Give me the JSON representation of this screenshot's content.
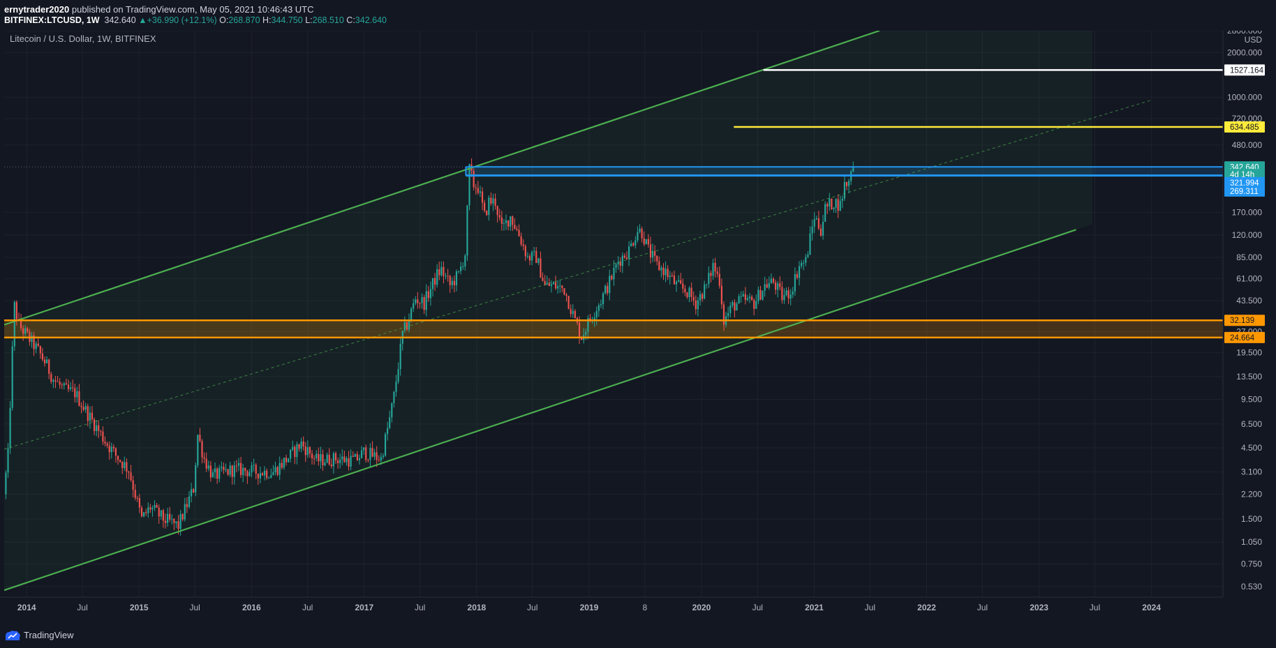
{
  "header": {
    "publisher": "ernytrader2020",
    "published_text": "published on TradingView.com, May 05, 2021 10:46:43 UTC",
    "symbol": "BITFINEX:LTCUSD, 1W",
    "last": "342.640",
    "change": "+36.990 (+12.1%)",
    "o_label": "O:",
    "o": "268.870",
    "h_label": "H:",
    "h": "344.750",
    "l_label": "L:",
    "l": "268.510",
    "c_label": "C:",
    "c": "342.640"
  },
  "footer": {
    "brand": "TradingView"
  },
  "colors": {
    "background": "#131722",
    "up": "#26a69a",
    "down": "#ef5350",
    "channel": "#4caf50",
    "zone": "#ff9800",
    "box": "#2196f3",
    "yellow": "#ffeb3b",
    "white": "#ffffff"
  },
  "chart_data": {
    "type": "candlestick",
    "title": "Litecoin / U.S. Dollar, 1W, BITFINEX",
    "y_unit": "USD",
    "y_scale": "log",
    "ylim": [
      0.45,
      2800
    ],
    "xlim": [
      "2013-10-20",
      "2024-08-20"
    ],
    "y_ticks": [
      "2800.000",
      "2000.000",
      "1000.000",
      "720.000",
      "480.000",
      "170.000",
      "120.000",
      "85.000",
      "61.000",
      "43.500",
      "27.000",
      "19.500",
      "13.500",
      "9.500",
      "6.500",
      "4.500",
      "3.100",
      "2.200",
      "1.500",
      "1.050",
      "0.750",
      "0.530"
    ],
    "x_ticks": [
      {
        "date": "2014-01-01",
        "label": "2014"
      },
      {
        "date": "2014-07-01",
        "label": "Jul"
      },
      {
        "date": "2015-01-01",
        "label": "2015"
      },
      {
        "date": "2015-07-01",
        "label": "Jul"
      },
      {
        "date": "2016-01-01",
        "label": "2016"
      },
      {
        "date": "2016-07-01",
        "label": "Jul"
      },
      {
        "date": "2017-01-01",
        "label": "2017"
      },
      {
        "date": "2017-07-01",
        "label": "Jul"
      },
      {
        "date": "2018-01-01",
        "label": "2018"
      },
      {
        "date": "2018-07-01",
        "label": "Jul"
      },
      {
        "date": "2019-01-01",
        "label": "2019"
      },
      {
        "date": "2019-07-01",
        "label": "8"
      },
      {
        "date": "2020-01-01",
        "label": "2020"
      },
      {
        "date": "2020-07-01",
        "label": "Jul"
      },
      {
        "date": "2021-01-01",
        "label": "2021"
      },
      {
        "date": "2021-07-01",
        "label": "Jul"
      },
      {
        "date": "2022-01-01",
        "label": "2022"
      },
      {
        "date": "2022-07-01",
        "label": "Jul"
      },
      {
        "date": "2023-01-01",
        "label": "2023"
      },
      {
        "date": "2023-07-01",
        "label": "Jul"
      },
      {
        "date": "2024-01-01",
        "label": "2024"
      }
    ],
    "price_anchors": [
      [
        "2013-10-22",
        2.2
      ],
      [
        "2013-11-05",
        4.0
      ],
      [
        "2013-11-19",
        20.0
      ],
      [
        "2013-11-26",
        40.0
      ],
      [
        "2013-12-10",
        30.0
      ],
      [
        "2014-01-14",
        24.0
      ],
      [
        "2014-02-11",
        20.0
      ],
      [
        "2014-03-04",
        17.0
      ],
      [
        "2014-04-01",
        13.0
      ],
      [
        "2014-05-06",
        11.0
      ],
      [
        "2014-06-10",
        10.5
      ],
      [
        "2014-07-15",
        8.0
      ],
      [
        "2014-09-16",
        5.0
      ],
      [
        "2014-10-21",
        4.0
      ],
      [
        "2014-12-02",
        3.2
      ],
      [
        "2015-01-13",
        1.5
      ],
      [
        "2015-02-10",
        1.8
      ],
      [
        "2015-03-24",
        1.5
      ],
      [
        "2015-05-12",
        1.35
      ],
      [
        "2015-06-30",
        2.4
      ],
      [
        "2015-07-14",
        5.5
      ],
      [
        "2015-08-04",
        3.8
      ],
      [
        "2015-09-01",
        2.9
      ],
      [
        "2015-11-03",
        3.2
      ],
      [
        "2015-12-01",
        3.2
      ],
      [
        "2016-01-19",
        3.1
      ],
      [
        "2016-03-15",
        3.1
      ],
      [
        "2016-05-10",
        4.0
      ],
      [
        "2016-06-14",
        4.8
      ],
      [
        "2016-08-02",
        3.7
      ],
      [
        "2016-10-04",
        3.8
      ],
      [
        "2016-12-06",
        3.7
      ],
      [
        "2017-01-03",
        4.2
      ],
      [
        "2017-02-28",
        3.8
      ],
      [
        "2017-03-28",
        7.0
      ],
      [
        "2017-04-11",
        10.0
      ],
      [
        "2017-05-09",
        26.0
      ],
      [
        "2017-05-23",
        30.0
      ],
      [
        "2017-06-20",
        45.0
      ],
      [
        "2017-07-18",
        42.0
      ],
      [
        "2017-08-29",
        65.0
      ],
      [
        "2017-09-12",
        70.0
      ],
      [
        "2017-10-10",
        55.0
      ],
      [
        "2017-11-07",
        65.0
      ],
      [
        "2017-11-28",
        90.0
      ],
      [
        "2017-12-12",
        330.0
      ],
      [
        "2017-12-26",
        260.0
      ],
      [
        "2018-01-09",
        250.0
      ],
      [
        "2018-01-30",
        160.0
      ],
      [
        "2018-02-13",
        200.0
      ],
      [
        "2018-03-06",
        200.0
      ],
      [
        "2018-03-27",
        130.0
      ],
      [
        "2018-04-24",
        160.0
      ],
      [
        "2018-05-22",
        120.0
      ],
      [
        "2018-06-19",
        85.0
      ],
      [
        "2018-07-17",
        85.0
      ],
      [
        "2018-08-14",
        55.0
      ],
      [
        "2018-09-11",
        55.0
      ],
      [
        "2018-10-16",
        52.0
      ],
      [
        "2018-11-20",
        32.0
      ],
      [
        "2018-12-11",
        25.0
      ],
      [
        "2019-01-08",
        33.0
      ],
      [
        "2019-02-12",
        44.0
      ],
      [
        "2019-03-12",
        58.0
      ],
      [
        "2019-04-09",
        80.0
      ],
      [
        "2019-05-14",
        95.0
      ],
      [
        "2019-06-11",
        130.0
      ],
      [
        "2019-06-25",
        125.0
      ],
      [
        "2019-07-16",
        95.0
      ],
      [
        "2019-08-13",
        75.0
      ],
      [
        "2019-09-10",
        68.0
      ],
      [
        "2019-10-15",
        55.0
      ],
      [
        "2019-11-19",
        50.0
      ],
      [
        "2019-12-17",
        42.0
      ],
      [
        "2020-01-21",
        55.0
      ],
      [
        "2020-02-11",
        75.0
      ],
      [
        "2020-03-03",
        60.0
      ],
      [
        "2020-03-17",
        32.0
      ],
      [
        "2020-04-14",
        40.0
      ],
      [
        "2020-05-19",
        44.0
      ],
      [
        "2020-06-23",
        42.0
      ],
      [
        "2020-07-28",
        55.0
      ],
      [
        "2020-08-25",
        58.0
      ],
      [
        "2020-09-22",
        46.0
      ],
      [
        "2020-10-20",
        50.0
      ],
      [
        "2020-11-17",
        75.0
      ],
      [
        "2020-12-08",
        80.0
      ],
      [
        "2021-01-05",
        160.0
      ],
      [
        "2021-01-26",
        130.0
      ],
      [
        "2021-02-09",
        180.0
      ],
      [
        "2021-02-23",
        190.0
      ],
      [
        "2021-03-09",
        200.0
      ],
      [
        "2021-03-30",
        190.0
      ],
      [
        "2021-04-13",
        260.0
      ],
      [
        "2021-04-27",
        270.0
      ],
      [
        "2021-05-04",
        342.64
      ]
    ],
    "annotations": {
      "ascending_channel": {
        "upper": [
          [
            "2013-10-20",
            30.0
          ],
          [
            "2021-08-01",
            2800.0
          ]
        ],
        "lower": [
          [
            "2013-10-20",
            0.5
          ],
          [
            "2023-05-01",
            130.0
          ]
        ],
        "median": [
          [
            "2013-10-20",
            4.4
          ],
          [
            "2024-01-01",
            960.0
          ]
        ]
      },
      "support_zone": {
        "top": 32.139,
        "bottom": 24.664,
        "from": "2013-10-20"
      },
      "resistance_box": {
        "top": 342.64,
        "bottom": 300.0,
        "from": "2017-11-27"
      },
      "target_lines": [
        {
          "price": 1527.164,
          "from": "2020-07-20",
          "color": "#ffffff"
        },
        {
          "price": 634.485,
          "from": "2020-04-15",
          "color": "#ffeb3b"
        }
      ]
    },
    "price_labels": [
      {
        "text": "1527.164",
        "price": 1527.164,
        "bg": "#ffffff",
        "fg": "#131722"
      },
      {
        "text": "634.485",
        "price": 634.485,
        "bg": "#ffeb3b",
        "fg": "#131722"
      },
      {
        "text": "342.640",
        "price": 342.64,
        "bg": "#26a69a",
        "fg": "#ffffff"
      },
      {
        "text": "4d 14h",
        "price": 305.0,
        "bg": "#26a69a",
        "fg": "#ffffff"
      },
      {
        "text": "321.994",
        "price": 269.0,
        "bg": "#2196f3",
        "fg": "#ffffff"
      },
      {
        "text": "269.311",
        "price": 236.0,
        "bg": "#2196f3",
        "fg": "#ffffff"
      },
      {
        "text": "32.139",
        "price": 32.139,
        "bg": "#ff9800",
        "fg": "#131722"
      },
      {
        "text": "24.664",
        "price": 24.664,
        "bg": "#ff9800",
        "fg": "#131722"
      }
    ]
  }
}
